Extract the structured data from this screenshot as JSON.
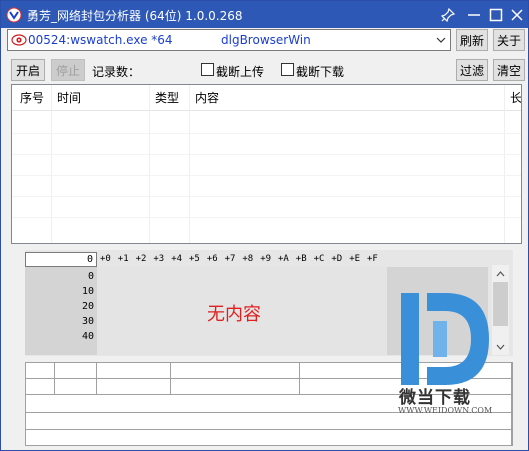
{
  "window": {
    "title": "勇芳_网络封包分析器 (64位) 1.0.0.268",
    "titlebar_color": "#2e58b5"
  },
  "titlebar_buttons": {
    "pin_icon": "pin-icon",
    "minimize_icon": "minimize-icon",
    "maximize_icon": "maximize-icon",
    "close_icon": "close-icon"
  },
  "process_combo": {
    "process": "00524:wswatch.exe *64",
    "window_class": "dlgBrowserWin",
    "text_color": "#1a3ecf"
  },
  "top_buttons": {
    "refresh": "刷新",
    "about": "关于"
  },
  "toolbar": {
    "start": "开启",
    "stop": "停止",
    "record_count_label": "记录数：",
    "record_count_value": "",
    "intercept_upload": "截断上传",
    "intercept_download": "截断下载",
    "filter": "过滤",
    "clear": "清空"
  },
  "packet_list": {
    "columns": [
      "序号",
      "时间",
      "类型",
      "内容",
      "长"
    ],
    "rows": []
  },
  "hex_view": {
    "offset_value": "0",
    "column_headers": [
      "+0",
      "+1",
      "+2",
      "+3",
      "+4",
      "+5",
      "+6",
      "+7",
      "+8",
      "+9",
      "+A",
      "+B",
      "+C",
      "+D",
      "+E",
      "+F"
    ],
    "row_addresses": [
      "0",
      "10",
      "20",
      "30",
      "40"
    ],
    "empty_message": "无内容",
    "empty_message_color": "#e02020"
  },
  "watermark": {
    "brand": "微当下载",
    "url": "WWW.WEIDOWN.COM",
    "logo_color": "#3a8fd9"
  }
}
